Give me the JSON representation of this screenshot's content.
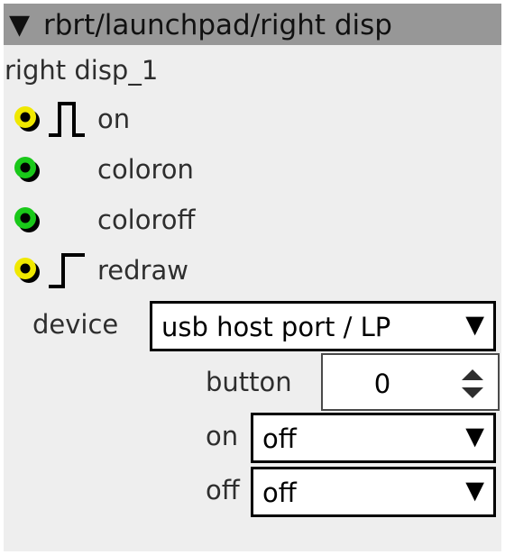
{
  "titlebar": {
    "collapse_glyph": "▼",
    "title": "rbrt/launchpad/right disp"
  },
  "node": {
    "name": "right disp_1"
  },
  "ports": [
    {
      "label": "on",
      "port_color": "#f0e800",
      "port_type": "gate"
    },
    {
      "label": "coloron",
      "port_color": "#19c819",
      "port_type": "value"
    },
    {
      "label": "coloroff",
      "port_color": "#19c819",
      "port_type": "value"
    },
    {
      "label": "redraw",
      "port_color": "#f0e800",
      "port_type": "trigger"
    }
  ],
  "params": {
    "device": {
      "label": "device",
      "value": "usb host port / LP",
      "arrow": "▼"
    },
    "button": {
      "label": "button",
      "value": "0"
    },
    "on": {
      "label": "on",
      "value": "off",
      "arrow": "▼"
    },
    "off": {
      "label": "off",
      "value": "off",
      "arrow": "▼"
    }
  }
}
